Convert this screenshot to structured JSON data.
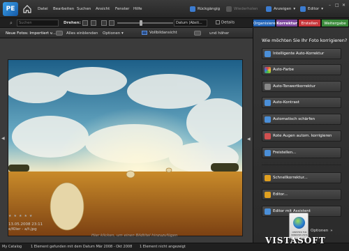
{
  "app": {
    "logo": "PE",
    "home_icon": "home-icon"
  },
  "menu": [
    "Datei",
    "Bearbeiten",
    "Suchen",
    "Ansicht",
    "Fenster",
    "Hilfe"
  ],
  "menu_right": {
    "undo": "Rückgängig",
    "redo": "Wiederholen",
    "views": "Anzeigen",
    "editor": "Editor"
  },
  "search": {
    "placeholder": "Suchen",
    "rotate_label": "Drehen:",
    "sort_value": "Datum (Absti...",
    "details_label": "Details"
  },
  "tabs": [
    "Organisieren",
    "Korrektur",
    "Erstellen",
    "Weitergabe"
  ],
  "bin_toolbar": {
    "label": "Neue Fotos: Importiert v...",
    "show": "Alles einblenden",
    "options": "Optionen",
    "fullscreen": "Vollbildansicht",
    "and_higher": "und höher"
  },
  "panel": {
    "title": "Wie möchten Sie Ihr Foto korrigieren?",
    "buttons": [
      {
        "label": "Intelligente Auto-Korrektur",
        "icon": "wand-icon",
        "color": "#4b8fd8"
      },
      {
        "label": "Auto-Farbe",
        "icon": "color-icon",
        "color": "#e0a020"
      },
      {
        "label": "Auto-Tonwertkorrektur",
        "icon": "levels-icon",
        "color": "#888888"
      },
      {
        "label": "Auto-Kontrast",
        "icon": "contrast-icon",
        "color": "#4b8fd8"
      },
      {
        "label": "Automatisch schärfen",
        "icon": "sharpen-icon",
        "color": "#4b8fd8"
      },
      {
        "label": "Rote Augen autom. korrigieren",
        "icon": "redeye-icon",
        "color": "#d05050"
      },
      {
        "label": "Freistellen...",
        "icon": "crop-icon",
        "color": "#4b8fd8"
      },
      {
        "label": "Schnellkorrektur...",
        "icon": "quickfix-icon",
        "color": "#e0a020"
      },
      {
        "label": "Editor...",
        "icon": "editor-icon",
        "color": "#e0a020"
      },
      {
        "label": "Editor mit Assistent",
        "icon": "guided-icon",
        "color": "#4b8fd8"
      }
    ],
    "options": "Optionen"
  },
  "photo_caption": {
    "stars": "★★★★★",
    "date": "13.05.2008 23:11",
    "filename": "e/Klier - a/t.jpg",
    "hint": "Hier klicken, um einen Bildtitel hinzuzufügen"
  },
  "status": {
    "catalog": "My Catalog",
    "found": "1 Element gefunden mit dem Datum Mär 2008 - Okt 2008",
    "hidden": "1 Element nicht angezeigt"
  },
  "vista_badge": {
    "text": "CERTIFIED FOR WINDOWS VISTA"
  },
  "watermark": "VISTASOFT"
}
